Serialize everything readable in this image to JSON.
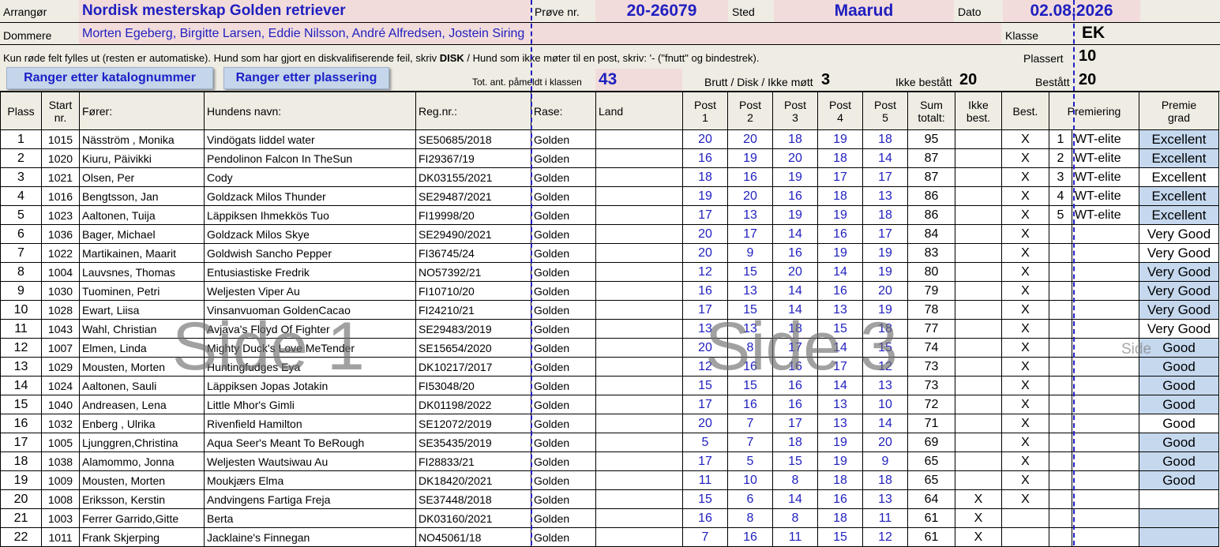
{
  "header": {
    "arranger_label": "Arrangør",
    "arranger_value": "Nordisk mesterskap Golden retriever",
    "trial_label": "Prøve nr.",
    "trial_value": "20-26079",
    "place_label": "Sted",
    "place_value": "Maarud",
    "date_label": "Dato",
    "date_value": "02.08.2026",
    "judges_label": "Dommere",
    "judges_value": "Morten Egeberg, Birgitte Larsen, Eddie Nilsson, André Alfredsen, Jostein Siring",
    "class_label": "Klasse",
    "class_value": "EK",
    "instruction_pre": "Kun røde felt fylles ut (resten er automatiske). Hund som har gjort en diskvalifiserende feil, skriv ",
    "instruction_disk": "DISK",
    "instruction_post": " / Hund som ikke møter til en post, skriv: '- (\"fnutt\" og bindestrek).",
    "placed_label": "Plassert",
    "placed_value": "10",
    "btn_catalog": "Ranger etter katalognummer",
    "btn_placement": "Ranger etter plassering",
    "total_label": "Tot. ant. påmeldt i klassen",
    "total_value": "43",
    "brutt_label": "Brutt / Disk / Ikke møtt",
    "brutt_value": "3",
    "notpassed_label": "Ikke bestått",
    "notpassed_value": "20",
    "passed_label": "Bestått",
    "passed_value": "20"
  },
  "columns": {
    "place": "Plass",
    "start_1": "Start",
    "start_2": "nr.",
    "handler": "Fører:",
    "dog": "Hundens navn:",
    "reg": "Reg.nr.:",
    "breed": "Rase:",
    "country": "Land",
    "post": "Post",
    "p1": "1",
    "p2": "2",
    "p3": "3",
    "p4": "4",
    "p5": "5",
    "sum_1": "Sum",
    "sum_2": "totalt:",
    "notbest_1": "Ikke",
    "notbest_2": "best.",
    "best": "Best.",
    "premiering": "Premiering",
    "grade_1": "Premie",
    "grade_2": "grad"
  },
  "rows": [
    {
      "place": "1",
      "start": "1015",
      "handler": "Näsström , Monika",
      "dog": "Vindögats liddel water",
      "reg": "SE50685/2018",
      "breed": "Golden",
      "s": [
        "20",
        "20",
        "18",
        "19",
        "18"
      ],
      "sum": "95",
      "nb": "",
      "b": "X",
      "pn": "1",
      "pr": "WT-elite",
      "g": "Excellent",
      "gb": true
    },
    {
      "place": "2",
      "start": "1020",
      "handler": "Kiuru, Päivikki",
      "dog": "Pendolinon Falcon In TheSun",
      "reg": "FI29367/19",
      "breed": "Golden",
      "s": [
        "16",
        "19",
        "20",
        "18",
        "14"
      ],
      "sum": "87",
      "nb": "",
      "b": "X",
      "pn": "2",
      "pr": "WT-elite",
      "g": "Excellent",
      "gb": true
    },
    {
      "place": "3",
      "start": "1021",
      "handler": "Olsen, Per",
      "dog": "Cody",
      "reg": "DK03155/2021",
      "breed": "Golden",
      "s": [
        "18",
        "16",
        "19",
        "17",
        "17"
      ],
      "sum": "87",
      "nb": "",
      "b": "X",
      "pn": "3",
      "pr": "WT-elite",
      "g": "Excellent",
      "gb": false
    },
    {
      "place": "4",
      "start": "1016",
      "handler": "Bengtsson, Jan",
      "dog": "Goldzack Milos Thunder",
      "reg": "SE29487/2021",
      "breed": "Golden",
      "s": [
        "19",
        "20",
        "16",
        "18",
        "13"
      ],
      "sum": "86",
      "nb": "",
      "b": "X",
      "pn": "4",
      "pr": "WT-elite",
      "g": "Excellent",
      "gb": true
    },
    {
      "place": "5",
      "start": "1023",
      "handler": "Aaltonen, Tuija",
      "dog": "Läppiksen Ihmekkös Tuo",
      "reg": "FI19998/20",
      "breed": "Golden",
      "s": [
        "17",
        "13",
        "19",
        "19",
        "18"
      ],
      "sum": "86",
      "nb": "",
      "b": "X",
      "pn": "5",
      "pr": "WT-elite",
      "g": "Excellent",
      "gb": true
    },
    {
      "place": "6",
      "start": "1036",
      "handler": "Bager, Michael",
      "dog": "Goldzack Milos Skye",
      "reg": "SE29490/2021",
      "breed": "Golden",
      "s": [
        "20",
        "17",
        "14",
        "16",
        "17"
      ],
      "sum": "84",
      "nb": "",
      "b": "X",
      "pn": "",
      "pr": "",
      "g": "Very Good",
      "gb": false
    },
    {
      "place": "7",
      "start": "1022",
      "handler": "Martikainen, Maarit",
      "dog": "Goldwish Sancho Pepper",
      "reg": "FI36745/24",
      "breed": "Golden",
      "s": [
        "20",
        "9",
        "16",
        "19",
        "19"
      ],
      "sum": "83",
      "nb": "",
      "b": "X",
      "pn": "",
      "pr": "",
      "g": "Very Good",
      "gb": false
    },
    {
      "place": "8",
      "start": "1004",
      "handler": "Lauvsnes, Thomas",
      "dog": "Entusiastiske Fredrik",
      "reg": "NO57392/21",
      "breed": "Golden",
      "s": [
        "12",
        "15",
        "20",
        "14",
        "19"
      ],
      "sum": "80",
      "nb": "",
      "b": "X",
      "pn": "",
      "pr": "",
      "g": "Very Good",
      "gb": true
    },
    {
      "place": "9",
      "start": "1030",
      "handler": "Tuominen, Petri",
      "dog": "Weljesten Viper Au",
      "reg": "FI10710/20",
      "breed": "Golden",
      "s": [
        "16",
        "13",
        "14",
        "16",
        "20"
      ],
      "sum": "79",
      "nb": "",
      "b": "X",
      "pn": "",
      "pr": "",
      "g": "Very Good",
      "gb": true
    },
    {
      "place": "10",
      "start": "1028",
      "handler": "Ewart, Liisa",
      "dog": "Vinsanvuoman GoldenCacao",
      "reg": "FI24210/21",
      "breed": "Golden",
      "s": [
        "17",
        "15",
        "14",
        "13",
        "19"
      ],
      "sum": "78",
      "nb": "",
      "b": "X",
      "pn": "",
      "pr": "",
      "g": "Very Good",
      "gb": true
    },
    {
      "place": "11",
      "start": "1043",
      "handler": "Wahl, Christian",
      "dog": "Avjava's Floyd Of Fighter",
      "reg": "SE29483/2019",
      "breed": "Golden",
      "s": [
        "13",
        "13",
        "18",
        "15",
        "18"
      ],
      "sum": "77",
      "nb": "",
      "b": "X",
      "pn": "",
      "pr": "",
      "g": "Very Good",
      "gb": false
    },
    {
      "place": "12",
      "start": "1007",
      "handler": "Elmen, Linda",
      "dog": "Mighty Duck's Love MeTender",
      "reg": "SE15654/2020",
      "breed": "Golden",
      "s": [
        "20",
        "8",
        "17",
        "14",
        "15"
      ],
      "sum": "74",
      "nb": "",
      "b": "X",
      "pn": "",
      "pr": "",
      "g": "Good",
      "gb": true
    },
    {
      "place": "13",
      "start": "1029",
      "handler": "Mousten, Morten",
      "dog": "Huntingfudges Eya",
      "reg": "DK10217/2017",
      "breed": "Golden",
      "s": [
        "12",
        "16",
        "16",
        "17",
        "12"
      ],
      "sum": "73",
      "nb": "",
      "b": "X",
      "pn": "",
      "pr": "",
      "g": "Good",
      "gb": true
    },
    {
      "place": "14",
      "start": "1024",
      "handler": "Aaltonen, Sauli",
      "dog": "Läppiksen Jopas Jotakin",
      "reg": "FI53048/20",
      "breed": "Golden",
      "s": [
        "15",
        "15",
        "16",
        "14",
        "13"
      ],
      "sum": "73",
      "nb": "",
      "b": "X",
      "pn": "",
      "pr": "",
      "g": "Good",
      "gb": true
    },
    {
      "place": "15",
      "start": "1040",
      "handler": "Andreasen, Lena",
      "dog": "Little Mhor's Gimli",
      "reg": "DK01198/2022",
      "breed": "Golden",
      "s": [
        "17",
        "16",
        "16",
        "13",
        "10"
      ],
      "sum": "72",
      "nb": "",
      "b": "X",
      "pn": "",
      "pr": "",
      "g": "Good",
      "gb": true
    },
    {
      "place": "16",
      "start": "1032",
      "handler": "Enberg , Ulrika",
      "dog": "Rivenfield Hamilton",
      "reg": "SE12072/2019",
      "breed": "Golden",
      "s": [
        "20",
        "7",
        "17",
        "13",
        "14"
      ],
      "sum": "71",
      "nb": "",
      "b": "X",
      "pn": "",
      "pr": "",
      "g": "Good",
      "gb": false
    },
    {
      "place": "17",
      "start": "1005",
      "handler": "Ljunggren,Christina",
      "dog": "Aqua Seer's Meant To BeRough",
      "reg": "SE35435/2019",
      "breed": "Golden",
      "s": [
        "5",
        "7",
        "18",
        "19",
        "20"
      ],
      "sum": "69",
      "nb": "",
      "b": "X",
      "pn": "",
      "pr": "",
      "g": "Good",
      "gb": true
    },
    {
      "place": "18",
      "start": "1038",
      "handler": "Alamommo, Jonna",
      "dog": "Weljesten Wautsiwau Au",
      "reg": "FI28833/21",
      "breed": "Golden",
      "s": [
        "17",
        "5",
        "15",
        "19",
        "9"
      ],
      "sum": "65",
      "nb": "",
      "b": "X",
      "pn": "",
      "pr": "",
      "g": "Good",
      "gb": true
    },
    {
      "place": "19",
      "start": "1009",
      "handler": "Mousten, Morten",
      "dog": "Moukjærs Elma",
      "reg": "DK18420/2021",
      "breed": "Golden",
      "s": [
        "11",
        "10",
        "8",
        "18",
        "18"
      ],
      "sum": "65",
      "nb": "",
      "b": "X",
      "pn": "",
      "pr": "",
      "g": "Good",
      "gb": true
    },
    {
      "place": "20",
      "start": "1008",
      "handler": "Eriksson, Kerstin",
      "dog": "Andvingens Fartiga Freja",
      "reg": "SE37448/2018",
      "breed": "Golden",
      "s": [
        "15",
        "6",
        "14",
        "16",
        "13"
      ],
      "sum": "64",
      "nb": "X",
      "b": "X",
      "pn": "",
      "pr": "",
      "g": "",
      "gb": false
    },
    {
      "place": "21",
      "start": "1003",
      "handler": "Ferrer Garrido,Gitte",
      "dog": "Berta",
      "reg": "DK03160/2021",
      "breed": "Golden",
      "s": [
        "16",
        "8",
        "8",
        "18",
        "11"
      ],
      "sum": "61",
      "nb": "X",
      "b": "",
      "pn": "",
      "pr": "",
      "g": "",
      "gb": true
    },
    {
      "place": "22",
      "start": "1011",
      "handler": "Frank Skjerping",
      "dog": "Jacklaine's Finnegan",
      "reg": "NO45061/18",
      "breed": "Golden",
      "s": [
        "7",
        "16",
        "11",
        "15",
        "12"
      ],
      "sum": "61",
      "nb": "X",
      "b": "",
      "pn": "",
      "pr": "",
      "g": "",
      "gb": true
    }
  ],
  "watermarks": {
    "side1": "Side 1",
    "side3": "Side 3",
    "side_small": "Side"
  }
}
